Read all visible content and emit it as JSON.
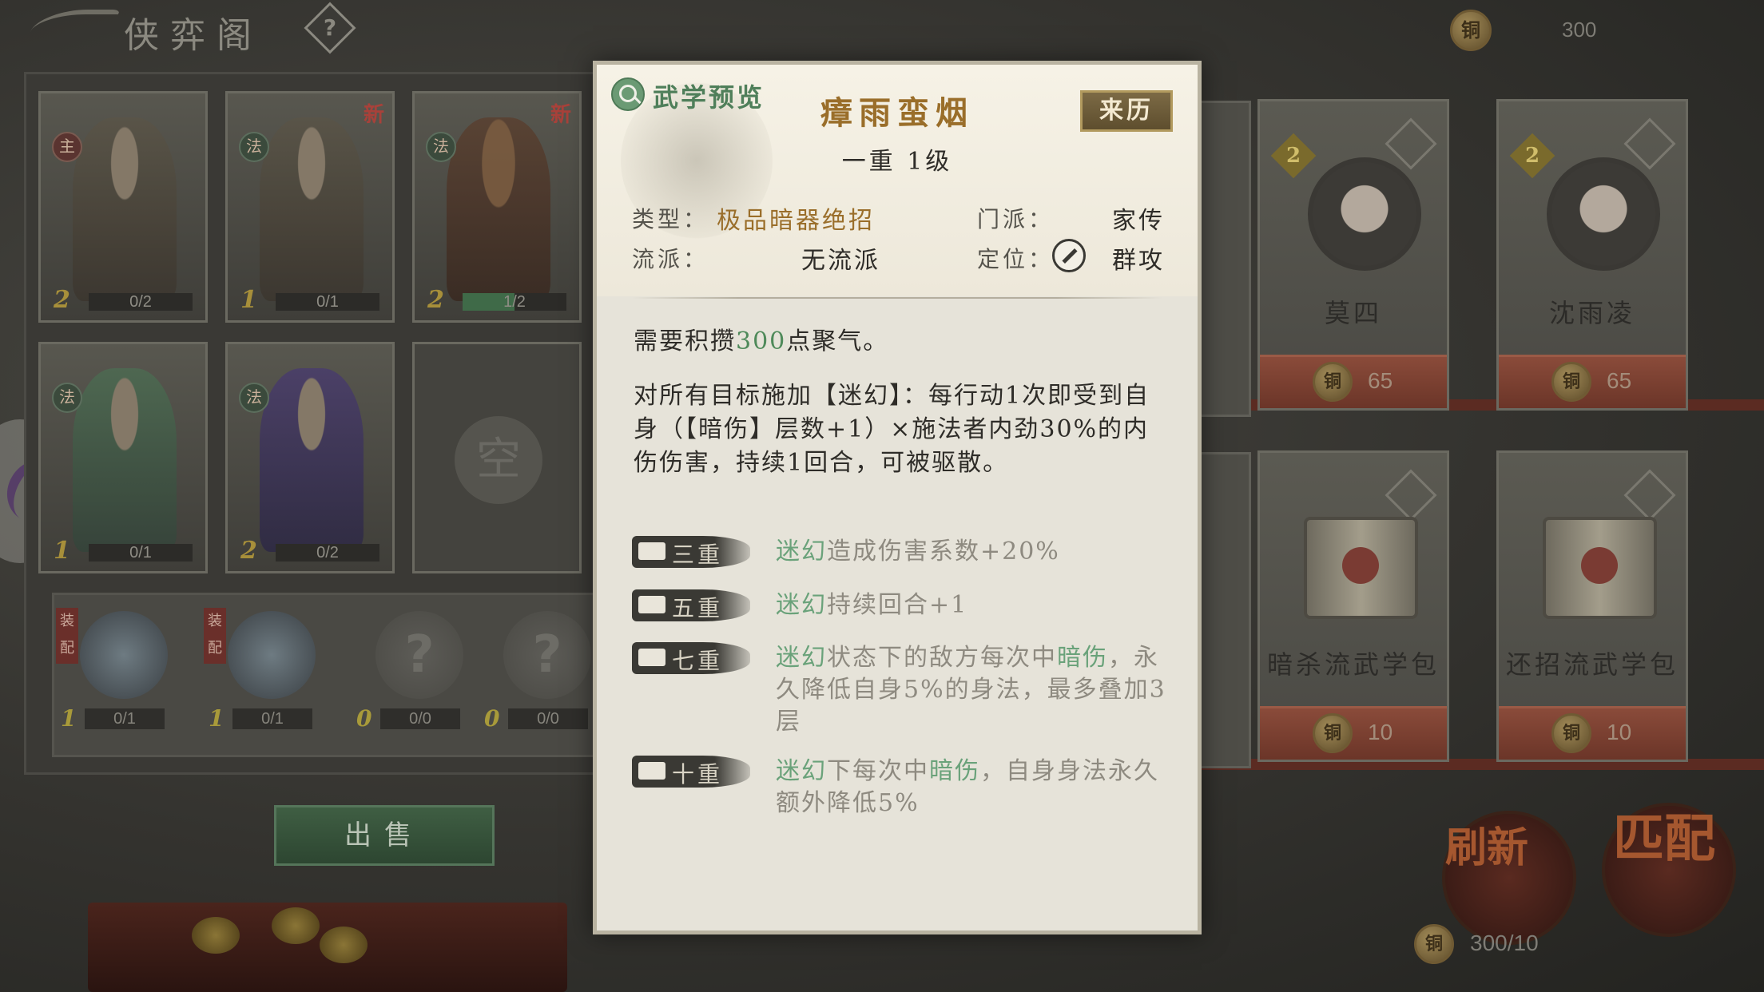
{
  "topbar": {
    "title": "侠弈阁",
    "help": "?",
    "currency_icon": "铜",
    "currency_value": "300"
  },
  "cards": [
    {
      "badge": "主",
      "level": "2",
      "progress": "0/2",
      "new": ""
    },
    {
      "badge": "法",
      "level": "1",
      "progress": "0/1",
      "new": "新"
    },
    {
      "badge": "法",
      "level": "2",
      "progress": "1/2",
      "new": "新"
    },
    {
      "badge": "法",
      "level": "1",
      "progress": "0/1",
      "new": ""
    },
    {
      "badge": "法",
      "level": "2",
      "progress": "0/2",
      "new": ""
    },
    {
      "empty_seal": "空"
    }
  ],
  "equips": [
    {
      "tag": "装配",
      "level": "1",
      "count": "0/1"
    },
    {
      "tag": "装配",
      "level": "1",
      "count": "0/1"
    },
    {
      "level": "0",
      "count": "0/0",
      "placeholder": "?"
    },
    {
      "level": "0",
      "count": "0/0",
      "placeholder": "?"
    }
  ],
  "sell_label": "出售",
  "shop": {
    "items": [
      {
        "name": "莫四",
        "count": "2",
        "price": "65"
      },
      {
        "name": "沈雨凌",
        "count": "2",
        "price": "65"
      },
      {
        "name": "暗杀流武学包",
        "price": "10"
      },
      {
        "name": "还招流武学包",
        "price": "10"
      }
    ],
    "refresh_label": "刷新",
    "match_label": "匹配",
    "bottom_cost": "300/10"
  },
  "modal": {
    "preview_label": "武学预览",
    "skill_name": "瘴雨蛮烟",
    "origin_button": "来历",
    "level": "一重 1级",
    "type_label": "类型：",
    "type_value": "极品暗器绝招",
    "sect_label": "门派：",
    "sect_value": "家传",
    "school_label": "流派：",
    "school_value": "无流派",
    "role_label": "定位：",
    "role_value": "群攻",
    "cost_pre": "需要积攒",
    "cost_num": "300",
    "cost_post": "点聚气。",
    "description": "对所有目标施加【迷幻】：每行动1次即受到自身（【暗伤】层数+1）×施法者内劲30%的内伤伤害，持续1回合，可被驱散。",
    "tiers": [
      {
        "label": "三重",
        "hl": "迷幻",
        "rest": "造成伤害系数+20%"
      },
      {
        "label": "五重",
        "hl": "迷幻",
        "rest": "持续回合+1"
      },
      {
        "label": "七重",
        "hl": "迷幻",
        "mid": "状态下的敌方每次中",
        "hl2": "暗伤",
        "rest": "，永久降低自身5%的身法，最多叠加3层"
      },
      {
        "label": "十重",
        "hl": "迷幻",
        "mid": "下每次中",
        "hl2": "暗伤",
        "rest": "，自身身法永久额外降低5%"
      }
    ]
  }
}
